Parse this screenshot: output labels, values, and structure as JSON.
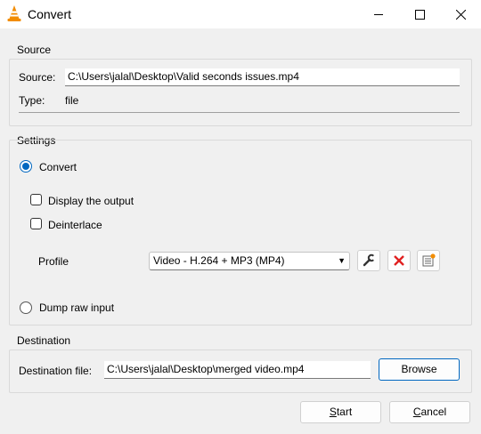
{
  "window": {
    "title": "Convert"
  },
  "source": {
    "group_label": "Source",
    "source_label": "Source:",
    "source_value": "C:\\Users\\jalal\\Desktop\\Valid seconds issues.mp4",
    "type_label": "Type:",
    "type_value": "file"
  },
  "settings": {
    "group_label": "Settings",
    "convert_label": "Convert",
    "convert_selected": true,
    "display_output_label": "Display the output",
    "display_output_checked": false,
    "deinterlace_label": "Deinterlace",
    "deinterlace_checked": false,
    "profile_label": "Profile",
    "profile_value": "Video - H.264 + MP3 (MP4)",
    "dump_raw_label": "Dump raw input",
    "dump_raw_selected": false
  },
  "destination": {
    "group_label": "Destination",
    "file_label": "Destination file:",
    "file_value": "C:\\Users\\jalal\\Desktop\\merged video.mp4",
    "browse_label": "Browse"
  },
  "actions": {
    "start_prefix": "S",
    "start_rest": "tart",
    "cancel_prefix": "C",
    "cancel_rest": "ancel"
  },
  "colors": {
    "accent": "#0067c0",
    "vlc_orange": "#f28c00",
    "delete_red": "#e02020"
  },
  "icons": [
    "vlc-cone-icon",
    "minimize-icon",
    "maximize-icon",
    "close-icon",
    "wrench-icon",
    "delete-x-icon",
    "new-profile-icon"
  ]
}
